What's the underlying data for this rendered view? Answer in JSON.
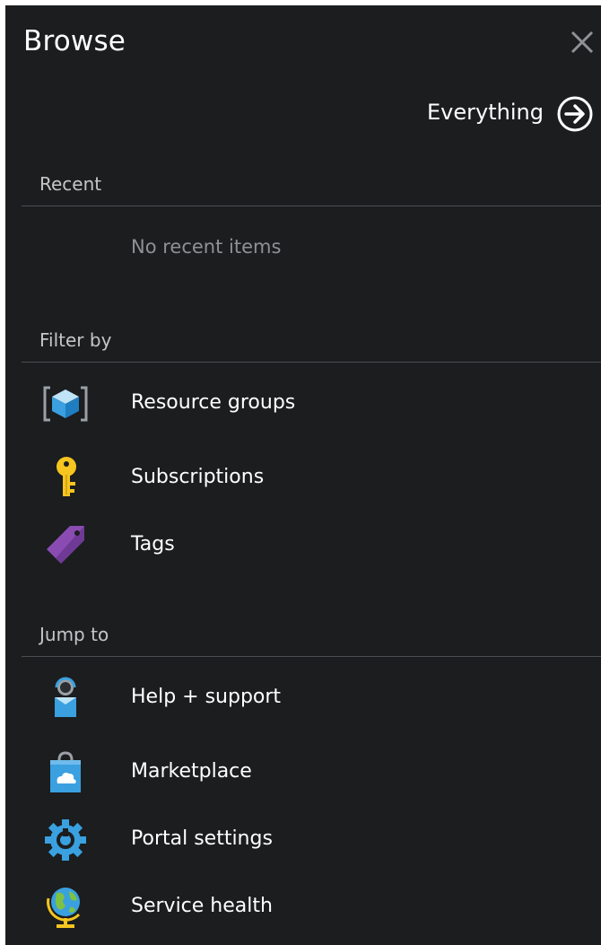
{
  "header": {
    "title": "Browse",
    "everything_label": "Everything"
  },
  "sections": {
    "recent": {
      "title": "Recent",
      "empty_text": "No recent items"
    },
    "filter_by": {
      "title": "Filter by",
      "items": [
        {
          "label": "Resource groups",
          "icon": "resource-groups-icon"
        },
        {
          "label": "Subscriptions",
          "icon": "key-icon"
        },
        {
          "label": "Tags",
          "icon": "tag-icon"
        }
      ]
    },
    "jump_to": {
      "title": "Jump to",
      "items": [
        {
          "label": "Help + support",
          "icon": "help-support-icon"
        },
        {
          "label": "Marketplace",
          "icon": "marketplace-bag-icon"
        },
        {
          "label": "Portal settings",
          "icon": "gear-icon"
        },
        {
          "label": "Service health",
          "icon": "globe-icon"
        }
      ]
    }
  },
  "colors": {
    "panel_background": "#1b1d1f",
    "divider": "#4c4f52",
    "muted_text": "#8e9194",
    "accent_blue": "#3aa0e0",
    "key_yellow": "#f6c51f",
    "tag_purple": "#8a4cb2"
  }
}
